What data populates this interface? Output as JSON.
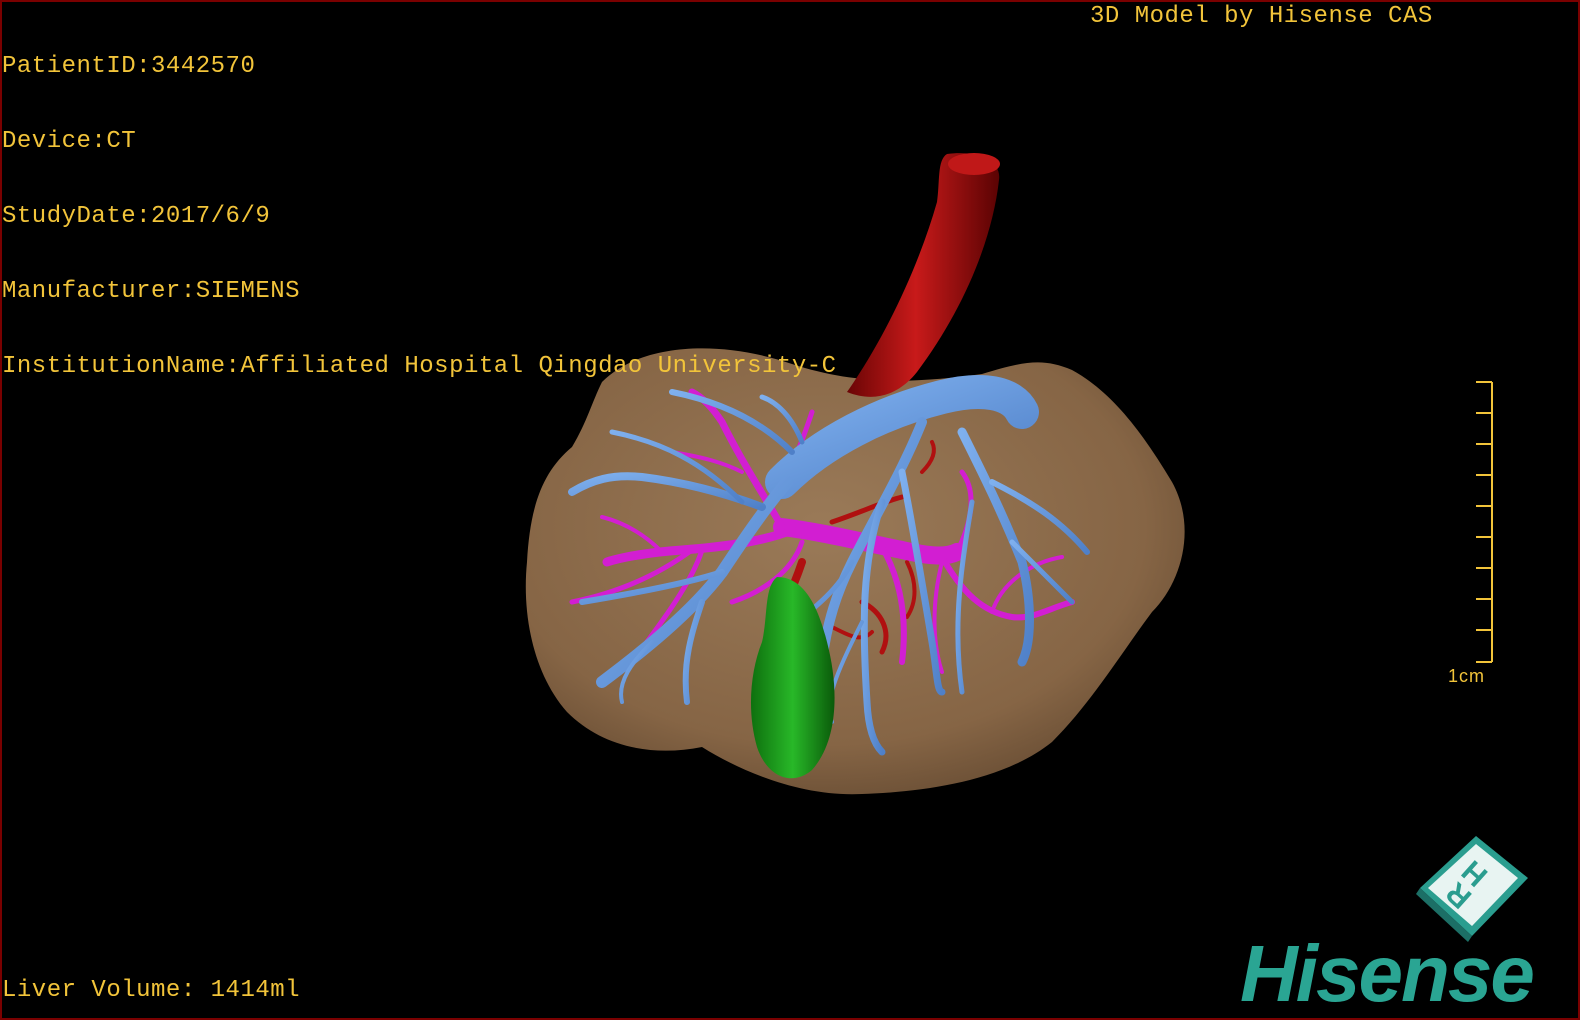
{
  "dicom_info": {
    "patient_id": "PatientID:3442570",
    "device": "Device:CT",
    "study_date": "StudyDate:2017/6/9",
    "manufacturer": "Manufacturer:SIEMENS",
    "institution_name": "InstitutionName:Affiliated Hospital Qingdao University-C"
  },
  "model_credit": "3D Model by Hisense CAS",
  "liver_volume": "Liver Volume: 1414ml",
  "scale_bar": {
    "label": "1cm"
  },
  "orientation_marker": {
    "letters": [
      "H",
      "R"
    ]
  },
  "brand": {
    "logo_text": "Hisense"
  },
  "colors": {
    "text": "#f2c43a",
    "liver": "#8a6b4c",
    "hepatic_vein": "#6fa0e0",
    "portal_vein": "#d21ed2",
    "artery": "#b01010",
    "gallbladder": "#1fa01f",
    "brand": "#2aa593",
    "frame": "#7a0000"
  },
  "structures": [
    "liver",
    "inferior-vena-cava",
    "hepatic-vein",
    "portal-vein",
    "hepatic-artery",
    "gallbladder"
  ]
}
